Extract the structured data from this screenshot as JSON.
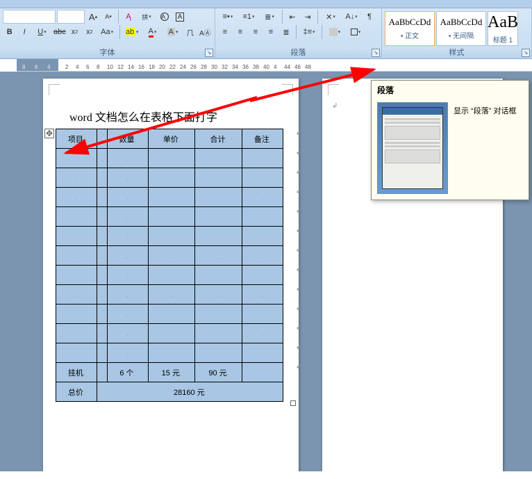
{
  "ribbon": {
    "groups": {
      "font": {
        "label": "字体"
      },
      "paragraph": {
        "label": "段落"
      },
      "styles": {
        "label": "样式"
      }
    },
    "styles": [
      {
        "sample": "AaBbCcDd",
        "name": "• 正文"
      },
      {
        "sample": "AaBbCcDd",
        "name": "• 无间隔"
      },
      {
        "sample": "AaB",
        "name": "标题 1"
      }
    ]
  },
  "tooltip": {
    "title": "段落",
    "text": "显示 “段落” 对话框"
  },
  "ruler": {
    "left_nums": [
      "8",
      "6",
      "4"
    ],
    "right_nums": [
      "2",
      "4",
      "6",
      "8",
      "10",
      "12",
      "14",
      "16",
      "18",
      "20",
      "22",
      "24",
      "26",
      "28",
      "30",
      "32",
      "34",
      "36",
      "38",
      "40",
      "4",
      "44",
      "46",
      "48"
    ]
  },
  "document": {
    "title": "word 文档怎么在表格下面打字",
    "headers": [
      "项目",
      "",
      "数量",
      "单价",
      "合计",
      "备注"
    ],
    "empty_rows": 11,
    "row_special": [
      "挂机",
      "",
      "6 个",
      "15 元",
      "90 元",
      ""
    ],
    "total_label": "总价",
    "total_value": "28160 元",
    "para_mark_text": "↲"
  }
}
